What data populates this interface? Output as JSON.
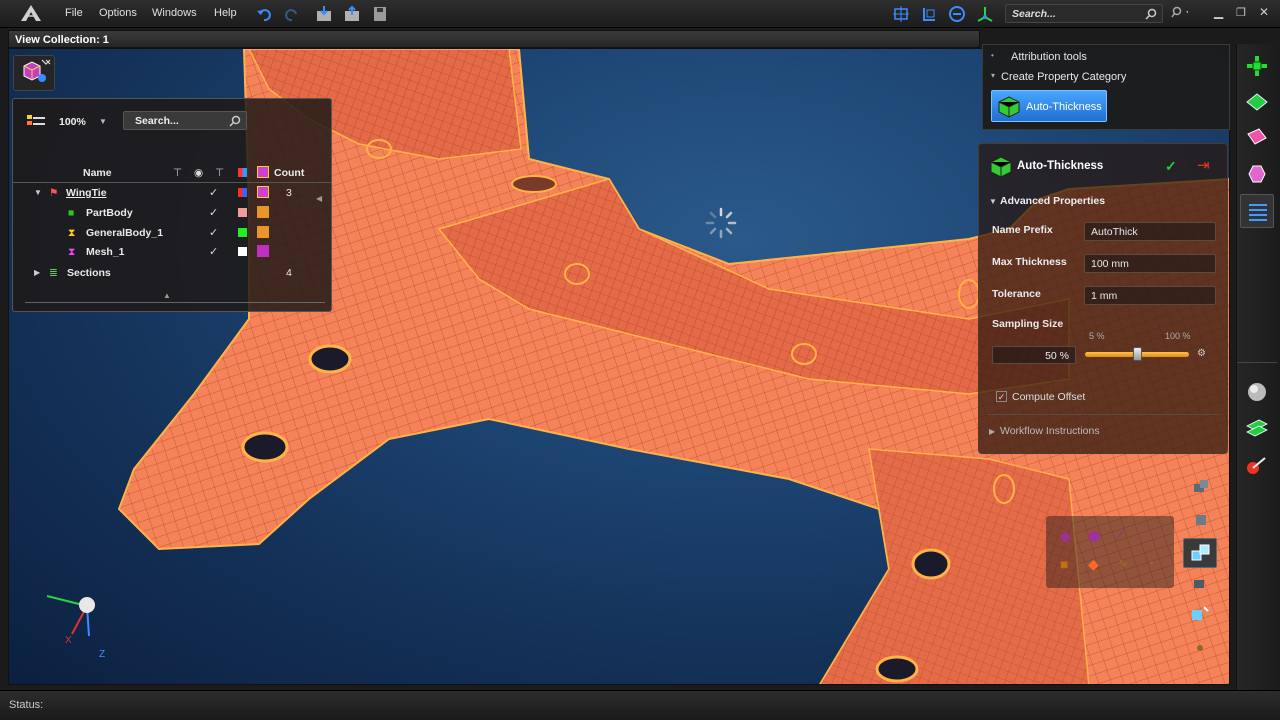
{
  "menu": {
    "file": "File",
    "options": "Options",
    "windows": "Windows",
    "help": "Help"
  },
  "search": {
    "placeholder": "Search..."
  },
  "view_collection": "View Collection: 1",
  "attribution": {
    "tools_label": "Attribution tools",
    "category_label": "Create Property Category",
    "button_label": "Auto-Thickness"
  },
  "auto_thickness": {
    "title": "Auto-Thickness",
    "section": "Advanced Properties",
    "name_prefix_label": "Name Prefix",
    "name_prefix_value": "AutoThick",
    "max_thickness_label": "Max Thickness",
    "max_thickness_value": "100 mm",
    "tolerance_label": "Tolerance",
    "tolerance_value": "1 mm",
    "sampling_label": "Sampling Size",
    "sampling_value": "50 %",
    "slider_min": "5 %",
    "slider_max": "100 %",
    "slider_level": 0.5,
    "compute_offset_label": "Compute Offset",
    "workflow_label": "Workflow Instructions"
  },
  "tree": {
    "zoom": "100%",
    "search_placeholder": "Search...",
    "col_name": "Name",
    "col_count": "Count",
    "rows": [
      {
        "name": "WingTie",
        "count": "3",
        "color": "#ff2a2a"
      },
      {
        "name": "PartBody",
        "count": "",
        "color": "#f39a9a"
      },
      {
        "name": "GeneralBody_1",
        "count": "",
        "color": "#22ee22"
      },
      {
        "name": "Mesh_1",
        "count": "",
        "color": "#ffffff"
      },
      {
        "name": "Sections",
        "count": "4",
        "color": ""
      }
    ]
  },
  "triad": {
    "x": "X",
    "z": "Z"
  },
  "status": "Status:",
  "colors": {
    "accent": "#2a7fe0",
    "mesh": "#ff7a4a",
    "mesh_line": "#ffb347",
    "viewport_bg": "#1d4573"
  }
}
